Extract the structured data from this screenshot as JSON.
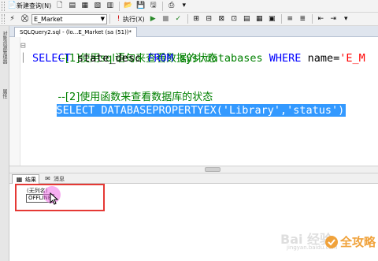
{
  "toolbar_top": {
    "new_query_label": "新建查询(N)"
  },
  "toolbar_second": {
    "database_value": "E_Market",
    "execute_label": "执行(X)"
  },
  "left_strip": {
    "label_1": "对象资源管理器",
    "label_2": "属性"
  },
  "document_tab": {
    "title": "SQLQuery2.sql - (lo...E_Market (sa (51))*"
  },
  "editor": {
    "line1_comment": "--[1]使用sql语句来查看数据的状态",
    "line2": {
      "kw_select": "SELECT",
      "col": " state_desc ",
      "kw_from": "FROM",
      "sp1": " ",
      "table": "sys.databases",
      "sp2": " ",
      "kw_where": "WHERE",
      "cond": " name=",
      "str": "'E_M"
    },
    "line3_comment": "--[2]使用函数来查看数据库的状态",
    "line4_selected": "SELECT DATABASEPROPERTYEX('Library','status')"
  },
  "results": {
    "tab_results": "结果",
    "tab_messages": "消息",
    "column_header": "(无列名)",
    "cell_value": "OFFLINE"
  },
  "watermark": {
    "baidu": "Bai 经验",
    "url": "jingyan.baidu.com",
    "brand": "全攻略"
  },
  "colors": {
    "selection": "#3399ff",
    "keyword": "#0000ff",
    "comment": "#008000",
    "string": "#ff0000",
    "annotation_box": "#e53935"
  }
}
